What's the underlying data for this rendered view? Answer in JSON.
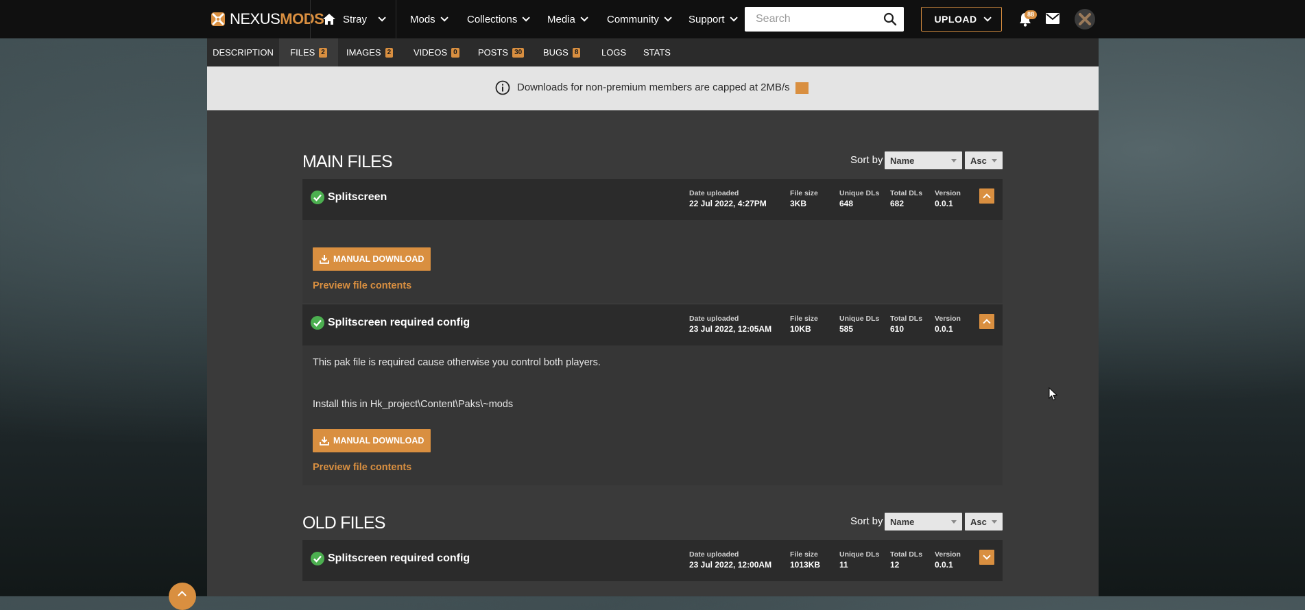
{
  "brand": {
    "logo_part1": "NEXUS",
    "logo_part2": "MODS"
  },
  "nav": {
    "game": "Stray",
    "items": [
      "Mods",
      "Collections",
      "Media",
      "Community",
      "Support"
    ],
    "search_placeholder": "Search",
    "upload_label": "UPLOAD",
    "notification_count": "88"
  },
  "tabs": [
    {
      "label": "DESCRIPTION",
      "count": ""
    },
    {
      "label": "FILES",
      "count": "2"
    },
    {
      "label": "IMAGES",
      "count": "2"
    },
    {
      "label": "VIDEOS",
      "count": "0"
    },
    {
      "label": "POSTS",
      "count": "30"
    },
    {
      "label": "BUGS",
      "count": "8"
    },
    {
      "label": "LOGS",
      "count": ""
    },
    {
      "label": "STATS",
      "count": ""
    }
  ],
  "notice": {
    "text": "Downloads for non-premium members are capped at 2MB/s"
  },
  "main_files": {
    "title": "MAIN FILES",
    "sort_label": "Sort by",
    "sort_field": "Name",
    "sort_order": "Asc",
    "files": [
      {
        "name": "Splitscreen",
        "date_label": "Date uploaded",
        "date": "22 Jul 2022, 4:27PM",
        "size_label": "File size",
        "size": "3KB",
        "unique_label": "Unique DLs",
        "unique": "648",
        "total_label": "Total DLs",
        "total": "682",
        "version_label": "Version",
        "version": "0.0.1",
        "download_label": "MANUAL DOWNLOAD",
        "preview_label": "Preview file contents"
      },
      {
        "name": "Splitscreen required config",
        "date_label": "Date uploaded",
        "date": "23 Jul 2022, 12:05AM",
        "size_label": "File size",
        "size": "10KB",
        "unique_label": "Unique DLs",
        "unique": "585",
        "total_label": "Total DLs",
        "total": "610",
        "version_label": "Version",
        "version": "0.0.1",
        "description_line1": "This pak file is required cause otherwise you control both players.",
        "description_line2": "Install this in Hk_project\\Content\\Paks\\~mods",
        "download_label": "MANUAL DOWNLOAD",
        "preview_label": "Preview file contents"
      }
    ]
  },
  "old_files": {
    "title": "OLD FILES",
    "sort_label": "Sort by",
    "sort_field": "Name",
    "sort_order": "Asc",
    "files": [
      {
        "name": "Splitscreen required config",
        "date_label": "Date uploaded",
        "date": "23 Jul 2022, 12:00AM",
        "size_label": "File size",
        "size": "1013KB",
        "unique_label": "Unique DLs",
        "unique": "11",
        "total_label": "Total DLs",
        "total": "12",
        "version_label": "Version",
        "version": "0.0.1"
      }
    ]
  },
  "colors": {
    "accent": "#d98f40",
    "topbar": "#101010",
    "panel": "#3a3a3a",
    "file_header": "#2b2b2b",
    "success": "#4caf50"
  }
}
